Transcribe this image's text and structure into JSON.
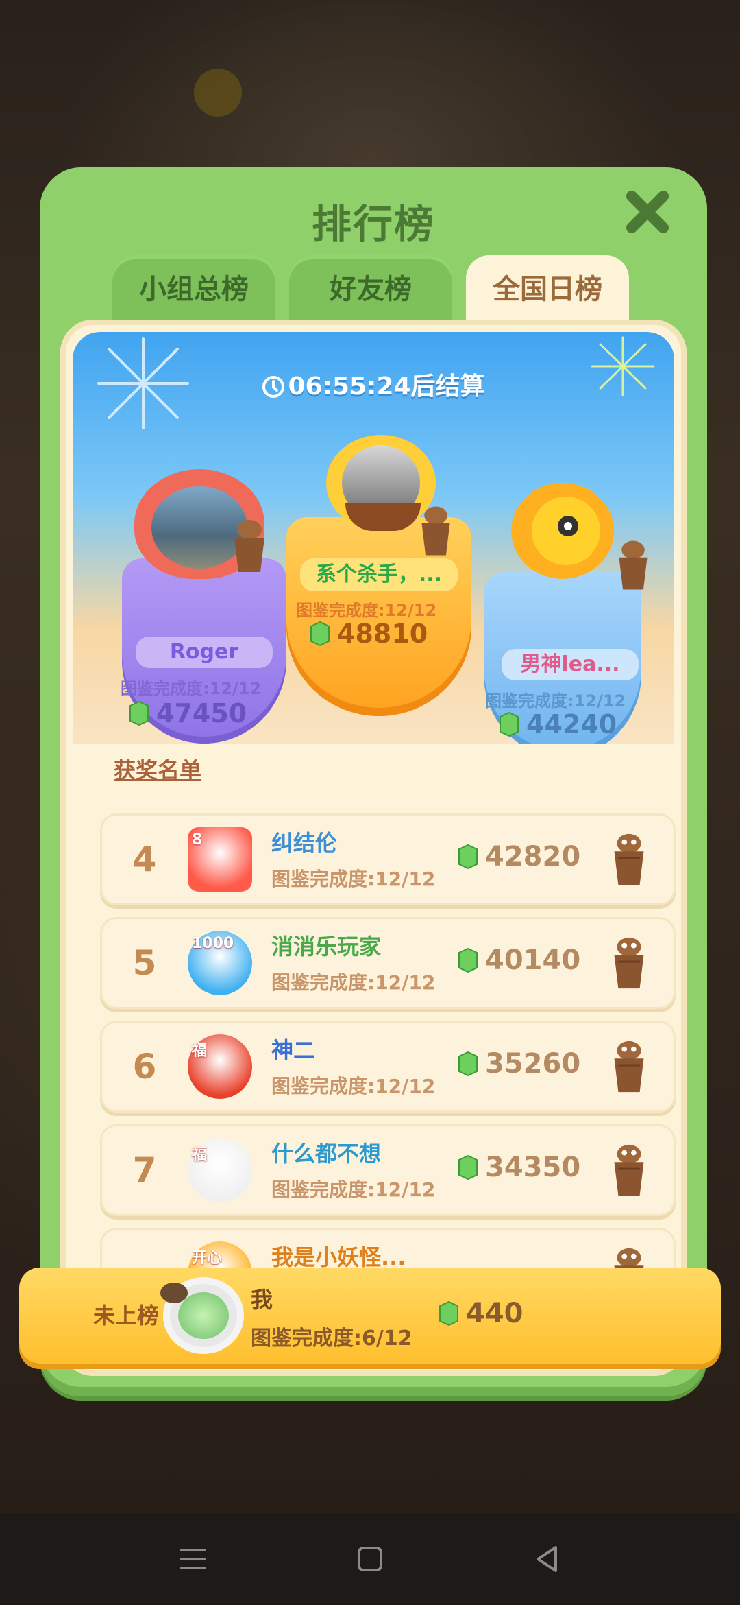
{
  "dialog": {
    "title": "排行榜",
    "tabs": [
      {
        "label": "小组总榜",
        "active": false
      },
      {
        "label": "好友榜",
        "active": false
      },
      {
        "label": "全国日榜",
        "active": true
      }
    ]
  },
  "timer": "06:55:24后结算",
  "podium": [
    {
      "rank": 2,
      "name": "Roger",
      "completion": "图鉴完成度:12/12",
      "score": "47450"
    },
    {
      "rank": 1,
      "name": "系个杀手，...",
      "completion": "图鉴完成度:12/12",
      "score": "48810"
    },
    {
      "rank": 3,
      "name": "男神lea...",
      "completion": "图鉴完成度:12/12",
      "score": "44240"
    }
  ],
  "winners_link": "获奖名单",
  "rows": [
    {
      "rank": "4",
      "name": "纠结伦",
      "completion": "图鉴完成度:12/12",
      "score": "42820",
      "name_color": "#3b8fd8",
      "avatar_badge": "8"
    },
    {
      "rank": "5",
      "name": "消消乐玩家",
      "completion": "图鉴完成度:12/12",
      "score": "40140",
      "name_color": "#4aa84a",
      "avatar_badge": "1000"
    },
    {
      "rank": "6",
      "name": "神二",
      "completion": "图鉴完成度:12/12",
      "score": "35260",
      "name_color": "#3b6fd8",
      "avatar_badge": "福"
    },
    {
      "rank": "7",
      "name": "什么都不想",
      "completion": "图鉴完成度:12/12",
      "score": "34350",
      "name_color": "#2b9ad0",
      "avatar_badge": "福"
    },
    {
      "rank": "",
      "name": "我是小妖怪...",
      "completion": "",
      "score": "",
      "name_color": "#e0801a",
      "avatar_badge": "开心"
    }
  ],
  "me": {
    "status": "未上榜",
    "name": "我",
    "completion": "图鉴完成度:6/12",
    "score": "440"
  },
  "colors": {
    "dialog_green": "#8fd06a",
    "panel_cream": "#fdf3d8",
    "gold": "#ffa21e"
  }
}
